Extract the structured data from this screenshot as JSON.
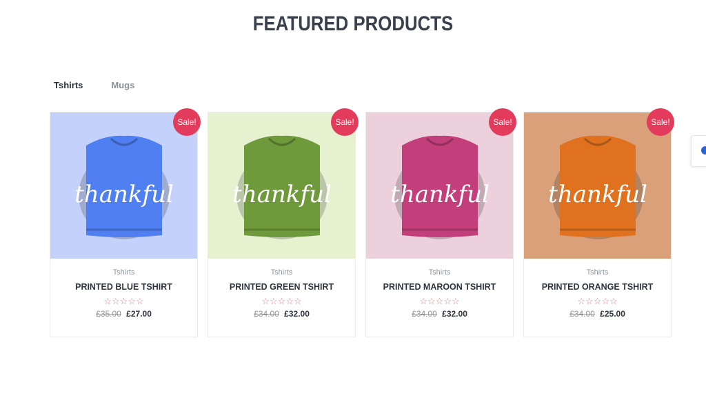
{
  "section": {
    "title": "FEATURED PRODUCTS"
  },
  "tabs": [
    {
      "label": "Tshirts",
      "active": true
    },
    {
      "label": "Mugs",
      "active": false
    }
  ],
  "products": [
    {
      "badge": "Sale!",
      "image_text": "thankful",
      "category": "Tshirts",
      "name": "PRINTED BLUE TSHIRT",
      "rating": "☆☆☆☆☆",
      "old_price": "£35.00",
      "price": "£27.00",
      "bg_color": "#c4d2fb",
      "shirt_color": "#4f7ff0"
    },
    {
      "badge": "Sale!",
      "image_text": "thankful",
      "category": "Tshirts",
      "name": "PRINTED GREEN TSHIRT",
      "rating": "☆☆☆☆☆",
      "old_price": "£34.00",
      "price": "£32.00",
      "bg_color": "#e5f1cf",
      "shirt_color": "#6f9a3c"
    },
    {
      "badge": "Sale!",
      "image_text": "thankful",
      "category": "Tshirts",
      "name": "PRINTED MAROON TSHIRT",
      "rating": "☆☆☆☆☆",
      "old_price": "£34.00",
      "price": "£32.00",
      "bg_color": "#ecd0dc",
      "shirt_color": "#c23f7b"
    },
    {
      "badge": "Sale!",
      "image_text": "thankful",
      "category": "Tshirts",
      "name": "PRINTED ORANGE TSHIRT",
      "rating": "☆☆☆☆☆",
      "old_price": "£34.00",
      "price": "£25.00",
      "bg_color": "#d9a07a",
      "shirt_color": "#e0721f"
    }
  ],
  "side_widget": {
    "icon": "color-palette-icon"
  }
}
